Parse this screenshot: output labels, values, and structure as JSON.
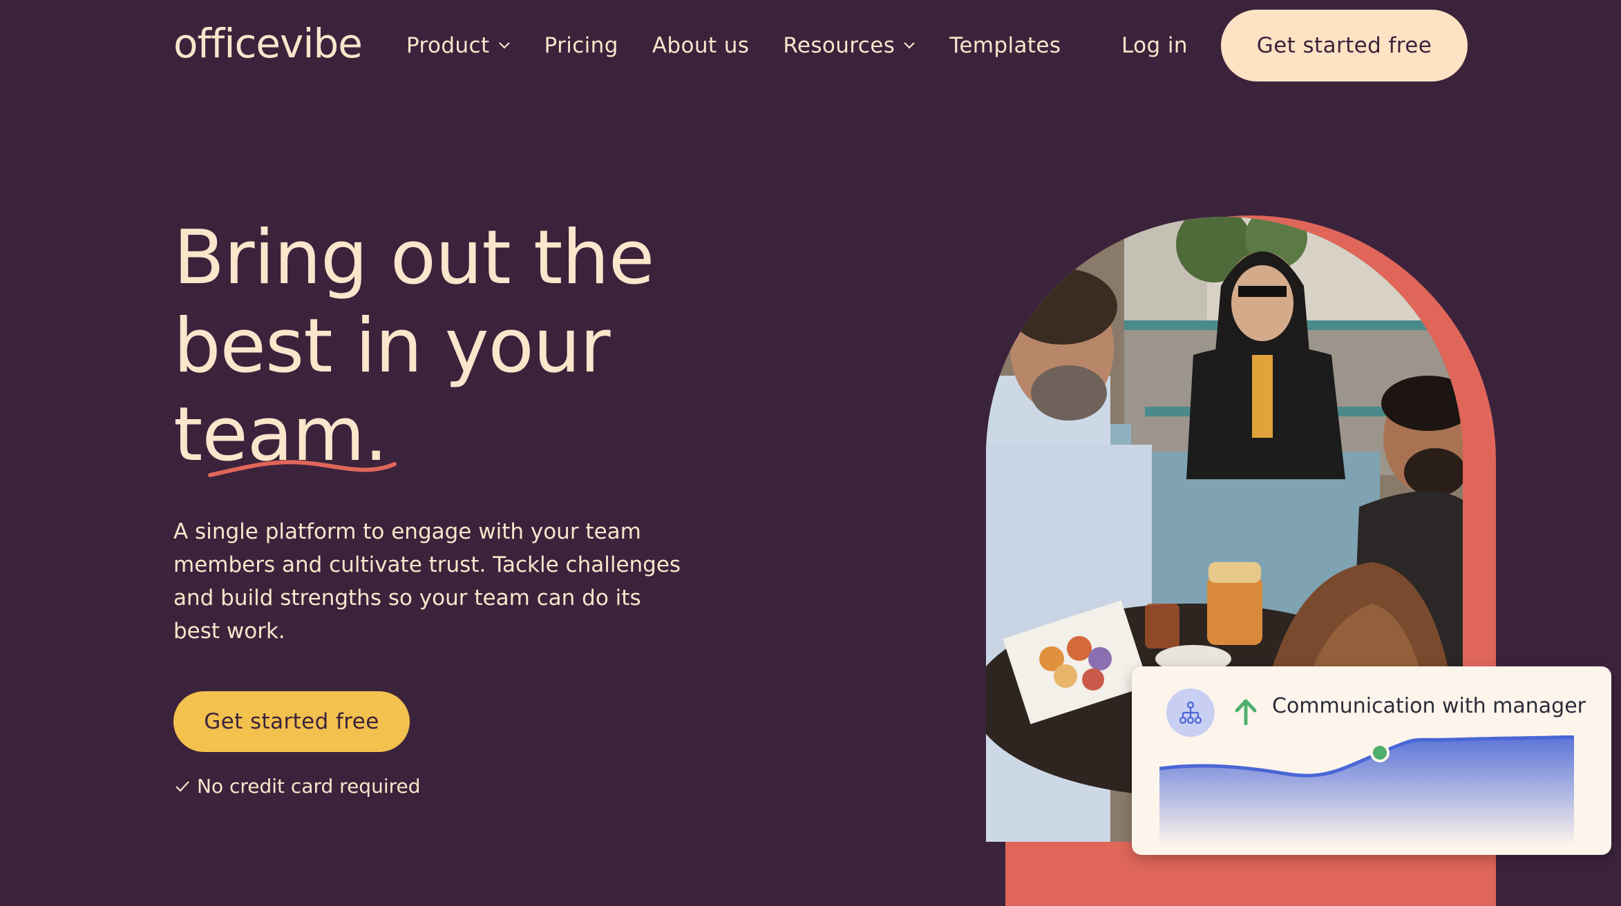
{
  "nav": {
    "logo": "officevibe",
    "items": [
      {
        "label": "Product",
        "has_dropdown": true
      },
      {
        "label": "Pricing",
        "has_dropdown": false
      },
      {
        "label": "About us",
        "has_dropdown": false
      },
      {
        "label": "Resources",
        "has_dropdown": true
      },
      {
        "label": "Templates",
        "has_dropdown": false
      }
    ],
    "login": "Log in",
    "cta": "Get started free"
  },
  "hero": {
    "headline_lines": [
      "Bring out the",
      "best in your",
      "team."
    ],
    "subtext": "A single platform to engage with your team members and cultivate trust. Tackle challenges and build strengths so your team can do its best work.",
    "cta": "Get started free",
    "note": "No credit card required"
  },
  "card": {
    "icon": "org-chart-icon",
    "trend_icon": "arrow-up-icon",
    "title": "Communication with manager"
  },
  "colors": {
    "background": "#3c233c",
    "cream": "#fbe6cc",
    "nav_cta": "#fde2c4",
    "hero_cta": "#f2c14e",
    "accent": "#e0665a",
    "chart_blue": "#4a66d6",
    "trend_green": "#4fb06e"
  }
}
